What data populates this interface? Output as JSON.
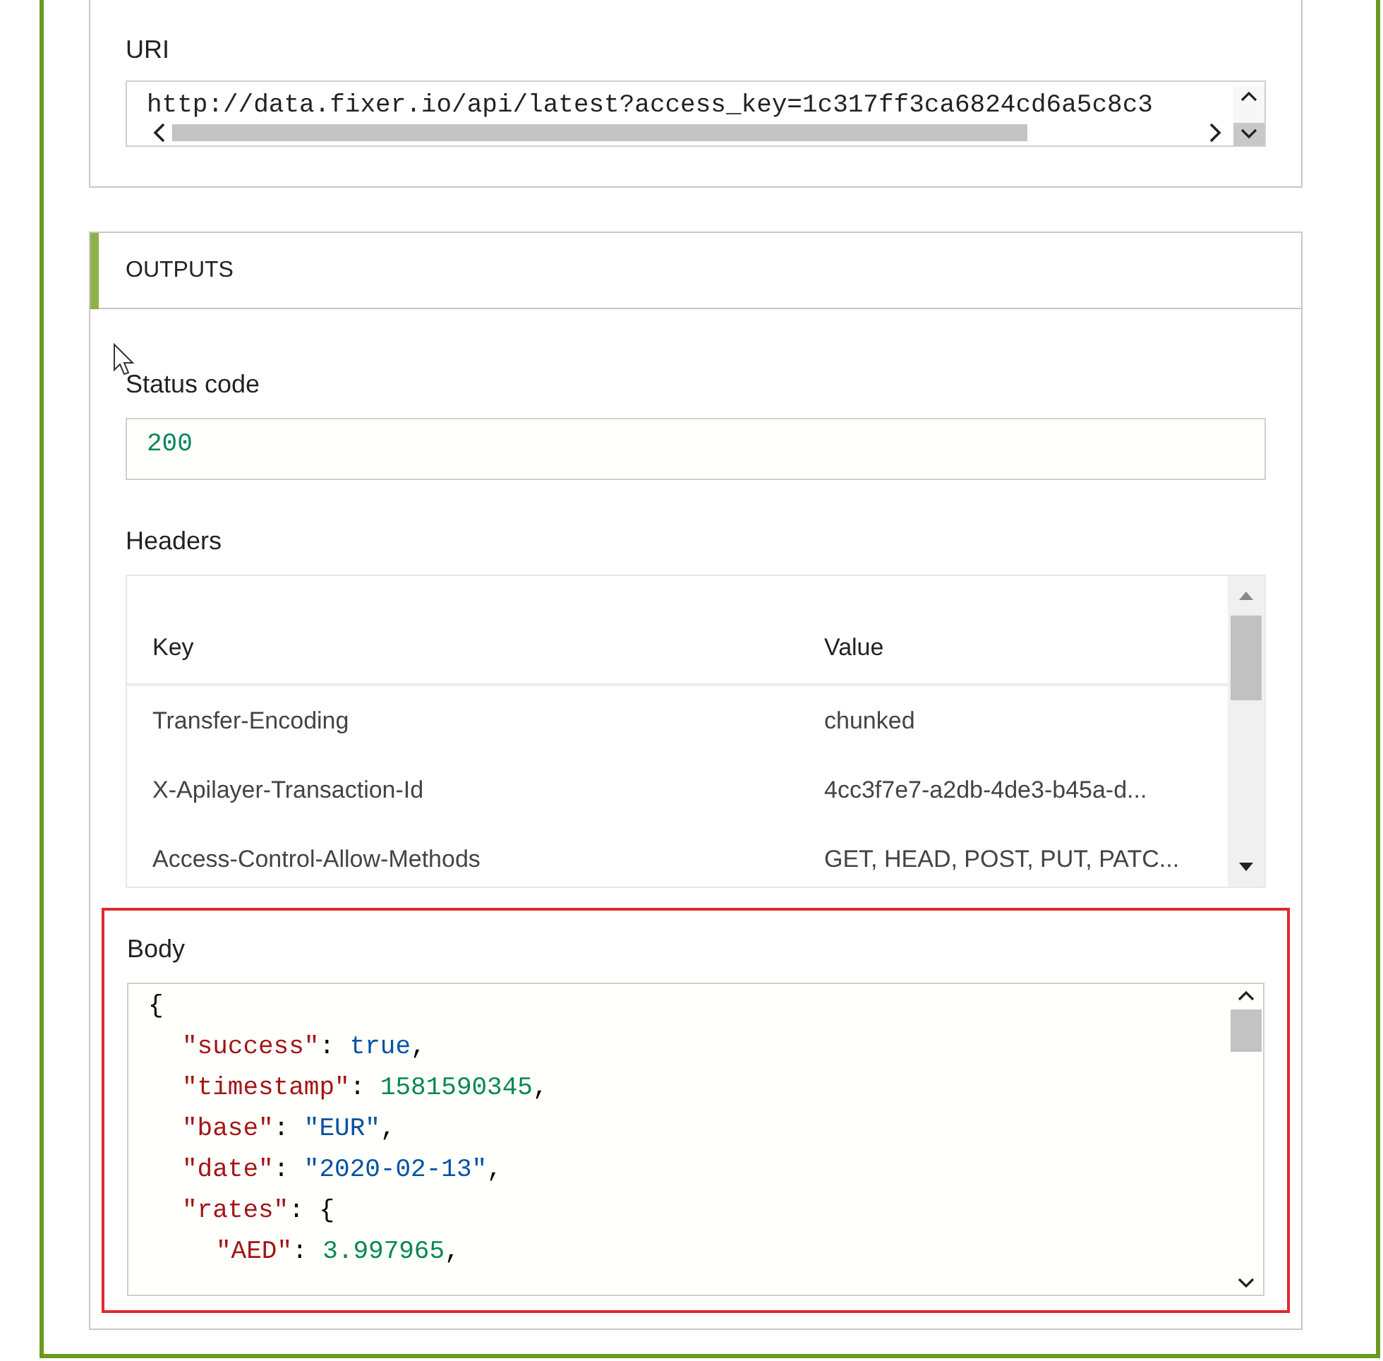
{
  "uri": {
    "label": "URI",
    "value": "http://data.fixer.io/api/latest?access_key=1c317ff3ca6824cd6a5c8c3"
  },
  "outputs": {
    "title": "OUTPUTS",
    "status_code": {
      "label": "Status code",
      "value": "200"
    },
    "headers": {
      "label": "Headers",
      "columns": [
        "Key",
        "Value"
      ],
      "rows": [
        {
          "key": "Transfer-Encoding",
          "value": "chunked"
        },
        {
          "key": "X-Apilayer-Transaction-Id",
          "value": "4cc3f7e7-a2db-4de3-b45a-d..."
        },
        {
          "key": "Access-Control-Allow-Methods",
          "value": "GET, HEAD, POST, PUT, PATC..."
        }
      ]
    },
    "body": {
      "label": "Body",
      "selected": true,
      "lines": [
        {
          "tokens": [
            {
              "kind": "punct",
              "text": "{"
            }
          ],
          "children": [
            {
              "tokens": [
                {
                  "kind": "key",
                  "text": "\"success\""
                },
                {
                  "kind": "punct",
                  "text": ": "
                },
                {
                  "kind": "boolean",
                  "text": "true"
                },
                {
                  "kind": "punct",
                  "text": ","
                }
              ]
            },
            {
              "tokens": [
                {
                  "kind": "key",
                  "text": "\"timestamp\""
                },
                {
                  "kind": "punct",
                  "text": ": "
                },
                {
                  "kind": "number",
                  "text": "1581590345"
                },
                {
                  "kind": "punct",
                  "text": ","
                }
              ]
            },
            {
              "tokens": [
                {
                  "kind": "key",
                  "text": "\"base\""
                },
                {
                  "kind": "punct",
                  "text": ": "
                },
                {
                  "kind": "string",
                  "text": "\"EUR\""
                },
                {
                  "kind": "punct",
                  "text": ","
                }
              ]
            },
            {
              "tokens": [
                {
                  "kind": "key",
                  "text": "\"date\""
                },
                {
                  "kind": "punct",
                  "text": ": "
                },
                {
                  "kind": "string",
                  "text": "\"2020-02-13\""
                },
                {
                  "kind": "punct",
                  "text": ","
                }
              ]
            },
            {
              "tokens": [
                {
                  "kind": "key",
                  "text": "\"rates\""
                },
                {
                  "kind": "punct",
                  "text": ": {"
                }
              ],
              "children": [
                {
                  "tokens": [
                    {
                      "kind": "key",
                      "text": "\"AED\""
                    },
                    {
                      "kind": "punct",
                      "text": ": "
                    },
                    {
                      "kind": "number",
                      "text": "3.997965"
                    },
                    {
                      "kind": "punct",
                      "text": ","
                    }
                  ]
                }
              ]
            }
          ]
        }
      ]
    }
  }
}
